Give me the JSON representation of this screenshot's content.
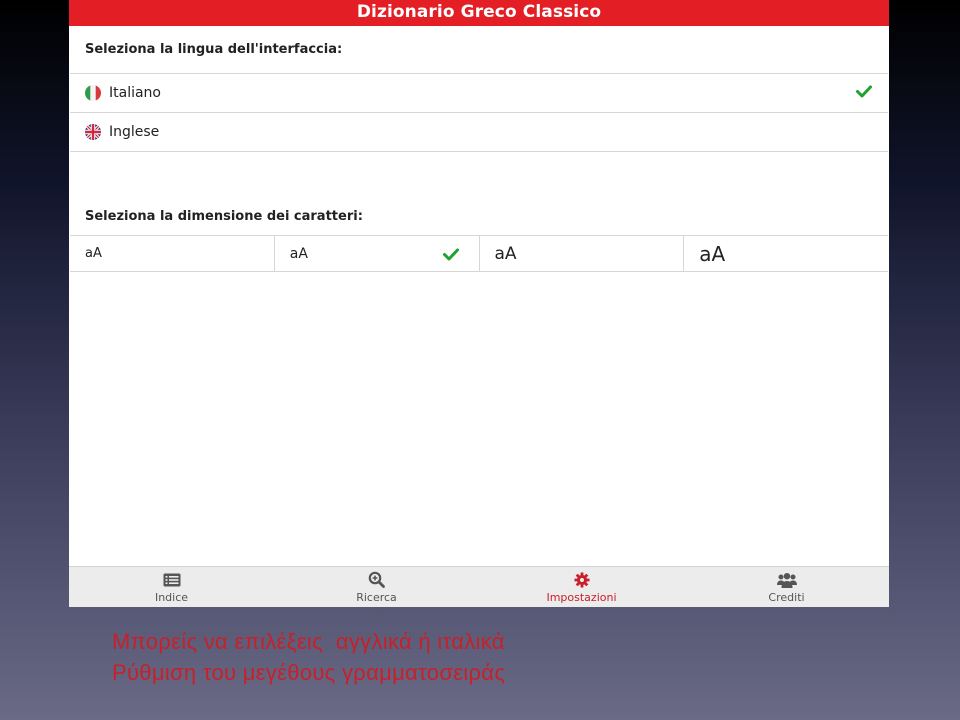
{
  "app": {
    "title": "Dizionario Greco Classico"
  },
  "language": {
    "header": "Seleziona la lingua dell'interfaccia:",
    "options": [
      {
        "label": "Italiano",
        "flag": "italy-flag-icon",
        "selected": true
      },
      {
        "label": "Inglese",
        "flag": "uk-flag-icon",
        "selected": false
      }
    ]
  },
  "font_size": {
    "header": "Seleziona la dimensione dei caratteri:",
    "options": [
      {
        "label": "aA",
        "selected": false
      },
      {
        "label": "aA",
        "selected": true
      },
      {
        "label": "aA",
        "selected": false
      },
      {
        "label": "aA",
        "selected": false
      }
    ]
  },
  "tabs": [
    {
      "label": "Indice",
      "icon": "list-icon",
      "active": false
    },
    {
      "label": "Ricerca",
      "icon": "zoom-search-icon",
      "active": false
    },
    {
      "label": "Impostazioni",
      "icon": "gear-icon",
      "active": true
    },
    {
      "label": "Crediti",
      "icon": "users-icon",
      "active": false
    }
  ],
  "caption": {
    "line1": "Μπορείς να επιλέξεις  αγγλικά ή ιταλικά",
    "line2": "Ρύθμιση του μεγέθους γραμματοσειράς"
  },
  "colors": {
    "brand_red": "#e31e24",
    "check_green": "#1fa22e",
    "active_tab": "#c8202a"
  }
}
